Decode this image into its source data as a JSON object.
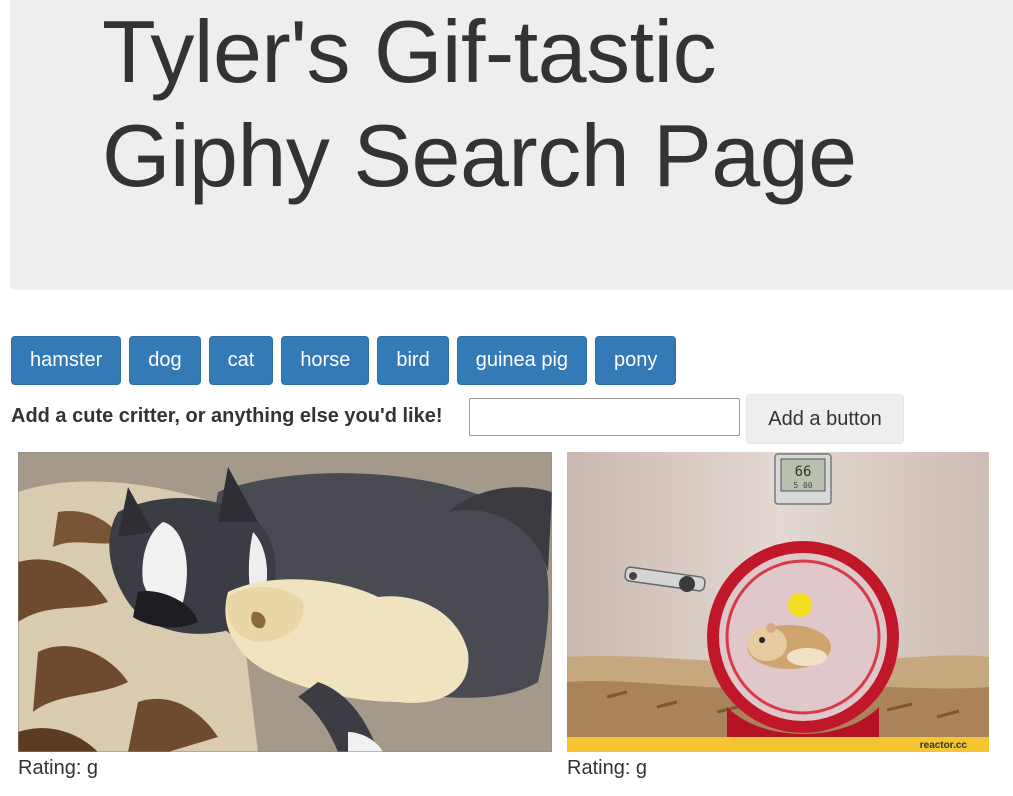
{
  "header": {
    "title_line1": "Tyler's Gif-tastic",
    "title_line2": "Giphy Search Page"
  },
  "animal_buttons": [
    "hamster",
    "dog",
    "cat",
    "horse",
    "bird",
    "guinea pig",
    "pony"
  ],
  "add_form": {
    "label": "Add a cute critter, or anything else you'd like!",
    "input_value": "",
    "button_label": "Add a button"
  },
  "gifs": [
    {
      "description": "dog cuddling guinea pig",
      "rating_text": "Rating: g"
    },
    {
      "description": "hamster running in wheel",
      "rating_text": "Rating: g",
      "watermark": "reactor.cc"
    }
  ],
  "colors": {
    "primary": "#337ab7",
    "jumbotron": "#eeeeee",
    "text": "#333333",
    "watermark_bar": "#f5c431"
  }
}
